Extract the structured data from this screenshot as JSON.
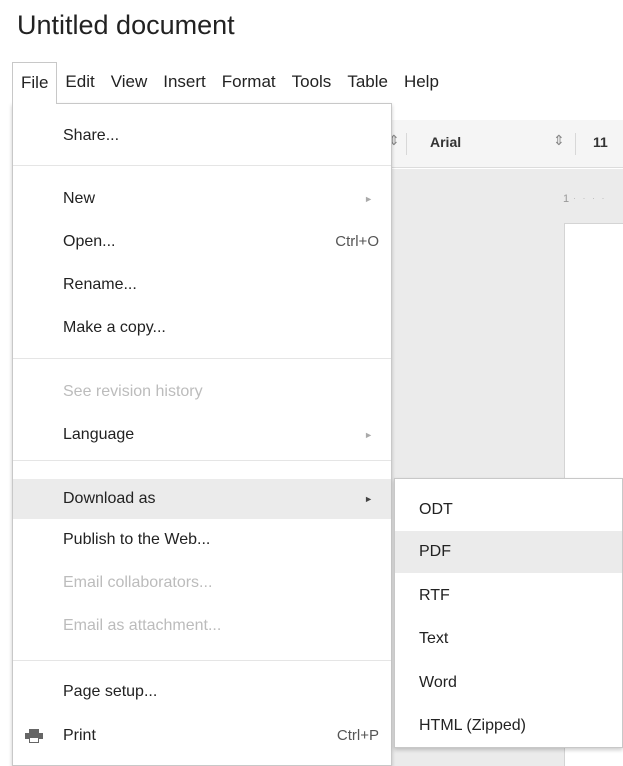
{
  "document": {
    "title": "Untitled document"
  },
  "menubar": {
    "items": [
      {
        "id": "file",
        "label": "File",
        "active": true
      },
      {
        "id": "edit",
        "label": "Edit"
      },
      {
        "id": "view",
        "label": "View"
      },
      {
        "id": "insert",
        "label": "Insert"
      },
      {
        "id": "format",
        "label": "Format"
      },
      {
        "id": "tools",
        "label": "Tools"
      },
      {
        "id": "table",
        "label": "Table"
      },
      {
        "id": "help",
        "label": "Help"
      }
    ]
  },
  "toolbar": {
    "font": "Arial",
    "font_size": "11"
  },
  "ruler": {
    "start_label": "1"
  },
  "file_menu": {
    "share": "Share...",
    "new": "New",
    "open": "Open...",
    "open_shortcut": "Ctrl+O",
    "rename": "Rename...",
    "make_copy": "Make a copy...",
    "revision_history": "See revision history",
    "language": "Language",
    "download_as": "Download as",
    "publish": "Publish to the Web...",
    "email_collaborators": "Email collaborators...",
    "email_attachment": "Email as attachment...",
    "page_setup": "Page setup...",
    "print": "Print",
    "print_shortcut": "Ctrl+P"
  },
  "download_submenu": {
    "items": [
      "ODT",
      "PDF",
      "RTF",
      "Text",
      "Word",
      "HTML (Zipped)"
    ],
    "highlighted": "PDF"
  },
  "icons": {
    "submenu_arrow": "triangle-right-icon",
    "print": "printer-icon",
    "select_arrows": "up-down-arrows-icon"
  },
  "colors": {
    "menu_hover": "#ebebeb",
    "disabled_text": "#bcbcbc",
    "border": "#c8c8c8"
  }
}
